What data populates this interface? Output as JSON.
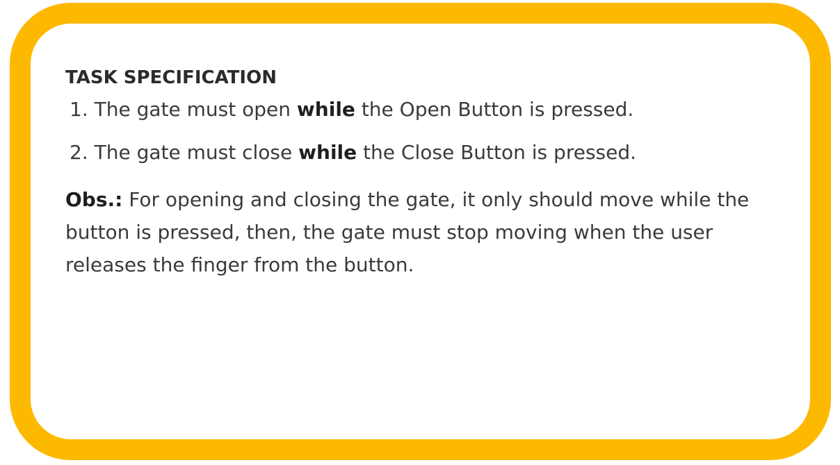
{
  "card": {
    "border_color": "#FDB900",
    "heading": "TASK SPECIFICATION",
    "items": [
      {
        "number": "1.",
        "before": "The gate must open",
        "emphasis": "while",
        "after": "the Open Button is pressed."
      },
      {
        "number": "2.",
        "before": "The gate must close",
        "emphasis": "while",
        "after": "the Close Button is pressed."
      }
    ],
    "note": {
      "label": "Obs.:",
      "text": "For opening and closing the gate, it only should move while the button is pressed, then, the gate must stop moving when the user releases the finger from the button."
    }
  }
}
